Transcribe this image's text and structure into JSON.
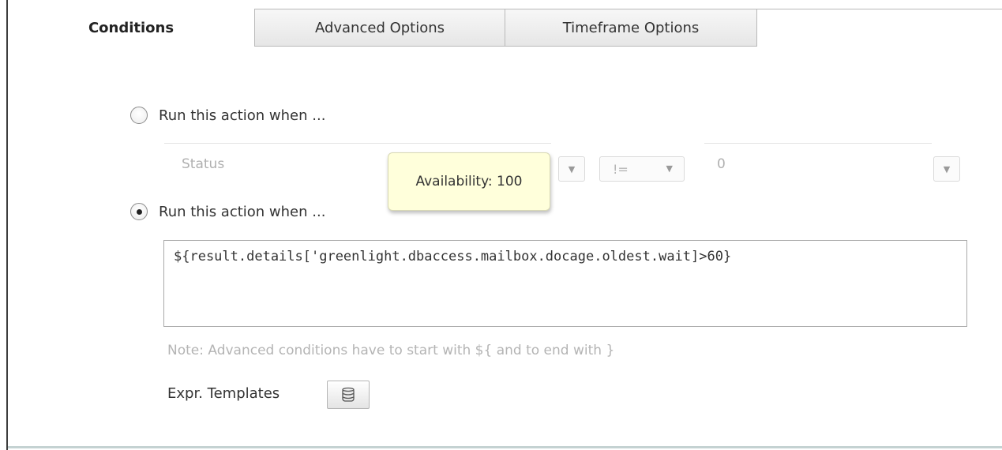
{
  "tabs": [
    {
      "label": "Conditions"
    },
    {
      "label": "Advanced Options"
    },
    {
      "label": "Timeframe Options"
    }
  ],
  "conditions": {
    "simple": {
      "label": "Run this action when ...",
      "selected": false,
      "field": "Status",
      "operator": "!=",
      "value": "0"
    },
    "advanced": {
      "label": "Run this action when ...",
      "selected": true,
      "expression": "${result.details['greenlight.dbaccess.mailbox.docage.oldest.wait]>60}"
    },
    "note": "Note: Advanced conditions have to start with ${ and to end with }",
    "templates_label": "Expr. Templates"
  },
  "tooltip": {
    "text": "Availability: 100"
  },
  "icons": {
    "dropdown": "caret-down-icon",
    "templates": "database-icon"
  },
  "colors": {
    "tooltip_bg": "#ffffdb",
    "disabled_text": "#b0b0b0"
  }
}
